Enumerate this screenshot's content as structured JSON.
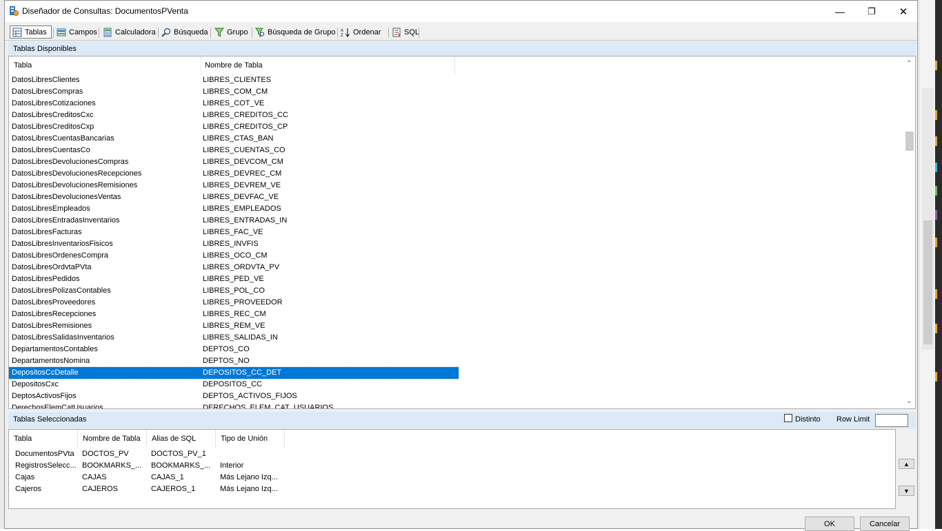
{
  "window": {
    "title": "Diseñador de Consultas: DocumentosPVenta",
    "minimize_glyph": "—",
    "maximize_glyph": "❐",
    "close_glyph": "✕"
  },
  "toolbar": {
    "tabs": [
      {
        "label": "Tablas",
        "icon": "table-icon",
        "active": true
      },
      {
        "label": "Campos",
        "icon": "fields-icon"
      },
      {
        "label": "Calculadora",
        "icon": "calculator-icon"
      },
      {
        "label": "Búsqueda",
        "icon": "search-icon"
      },
      {
        "label": "Grupo",
        "icon": "filter-icon"
      },
      {
        "label": "Búsqueda de Grupo",
        "icon": "group-search-icon"
      },
      {
        "label": "Ordenar",
        "icon": "sort-az-icon"
      },
      {
        "label": "SQL",
        "icon": "sql-icon"
      }
    ]
  },
  "available": {
    "label": "Tablas Disponibles",
    "columns": [
      "Tabla",
      "Nombre de Tabla"
    ],
    "rows": [
      [
        "DatosLibresClientes",
        "LIBRES_CLIENTES"
      ],
      [
        "DatosLibresCompras",
        "LIBRES_COM_CM"
      ],
      [
        "DatosLibresCotizaciones",
        "LIBRES_COT_VE"
      ],
      [
        "DatosLibresCreditosCxc",
        "LIBRES_CREDITOS_CC"
      ],
      [
        "DatosLibresCreditosCxp",
        "LIBRES_CREDITOS_CP"
      ],
      [
        "DatosLibresCuentasBancarias",
        "LIBRES_CTAS_BAN"
      ],
      [
        "DatosLibresCuentasCo",
        "LIBRES_CUENTAS_CO"
      ],
      [
        "DatosLibresDevolucionesCompras",
        "LIBRES_DEVCOM_CM"
      ],
      [
        "DatosLibresDevolucionesRecepciones",
        "LIBRES_DEVREC_CM"
      ],
      [
        "DatosLibresDevolucionesRemisiones",
        "LIBRES_DEVREM_VE"
      ],
      [
        "DatosLibresDevolucionesVentas",
        "LIBRES_DEVFAC_VE"
      ],
      [
        "DatosLibresEmpleados",
        "LIBRES_EMPLEADOS"
      ],
      [
        "DatosLibresEntradasInventarios",
        "LIBRES_ENTRADAS_IN"
      ],
      [
        "DatosLibresFacturas",
        "LIBRES_FAC_VE"
      ],
      [
        "DatosLibresInventariosFisicos",
        "LIBRES_INVFIS"
      ],
      [
        "DatosLibresOrdenesCompra",
        "LIBRES_OCO_CM"
      ],
      [
        "DatosLibresOrdvtaPVta",
        "LIBRES_ORDVTA_PV"
      ],
      [
        "DatosLibresPedidos",
        "LIBRES_PED_VE"
      ],
      [
        "DatosLibresPolizasContables",
        "LIBRES_POL_CO"
      ],
      [
        "DatosLibresProveedores",
        "LIBRES_PROVEEDOR"
      ],
      [
        "DatosLibresRecepciones",
        "LIBRES_REC_CM"
      ],
      [
        "DatosLibresRemisiones",
        "LIBRES_REM_VE"
      ],
      [
        "DatosLibresSalidasInventarios",
        "LIBRES_SALIDAS_IN"
      ],
      [
        "DepartamentosContables",
        "DEPTOS_CO"
      ],
      [
        "DepartamentosNomina",
        "DEPTOS_NO"
      ],
      [
        "DepositosCcDetalle",
        "DEPOSITOS_CC_DET"
      ],
      [
        "DepositosCxc",
        "DEPOSITOS_CC"
      ],
      [
        "DeptosActivosFijos",
        "DEPTOS_ACTIVOS_FIJOS"
      ],
      [
        "DerechosElemCatUsuarios",
        "DERECHOS_ELEM_CAT_USUARIOS"
      ]
    ],
    "selected_index": 25
  },
  "selected": {
    "label": "Tablas Seleccionadas",
    "distinct_label": "Distinto",
    "row_limit_label": "Row Limit",
    "row_limit_value": "",
    "columns": [
      "Tabla",
      "Nombre de Tabla",
      "Alias de SQL",
      "Tipo de Unión"
    ],
    "rows": [
      [
        "DocumentosPVta",
        "DOCTOS_PV",
        "DOCTOS_PV_1",
        ""
      ],
      [
        "RegistrosSelecc...",
        "BOOKMARKS_...",
        "BOOKMARKS_...",
        "Interior"
      ],
      [
        "Cajas",
        "CAJAS",
        "CAJAS_1",
        "Más Lejano Izq..."
      ],
      [
        "Cajeros",
        "CAJEROS",
        "CAJEROS_1",
        "Más Lejano Izq..."
      ]
    ]
  },
  "buttons": {
    "move_up_glyph": "▲",
    "move_down_glyph": "▼",
    "ok": "OK",
    "cancel": "Cancelar",
    "scroll_up_glyph": "⌃",
    "scroll_down_glyph": "⌄"
  },
  "colors": {
    "selection": "#0078d7",
    "band": "#dce9f7"
  }
}
